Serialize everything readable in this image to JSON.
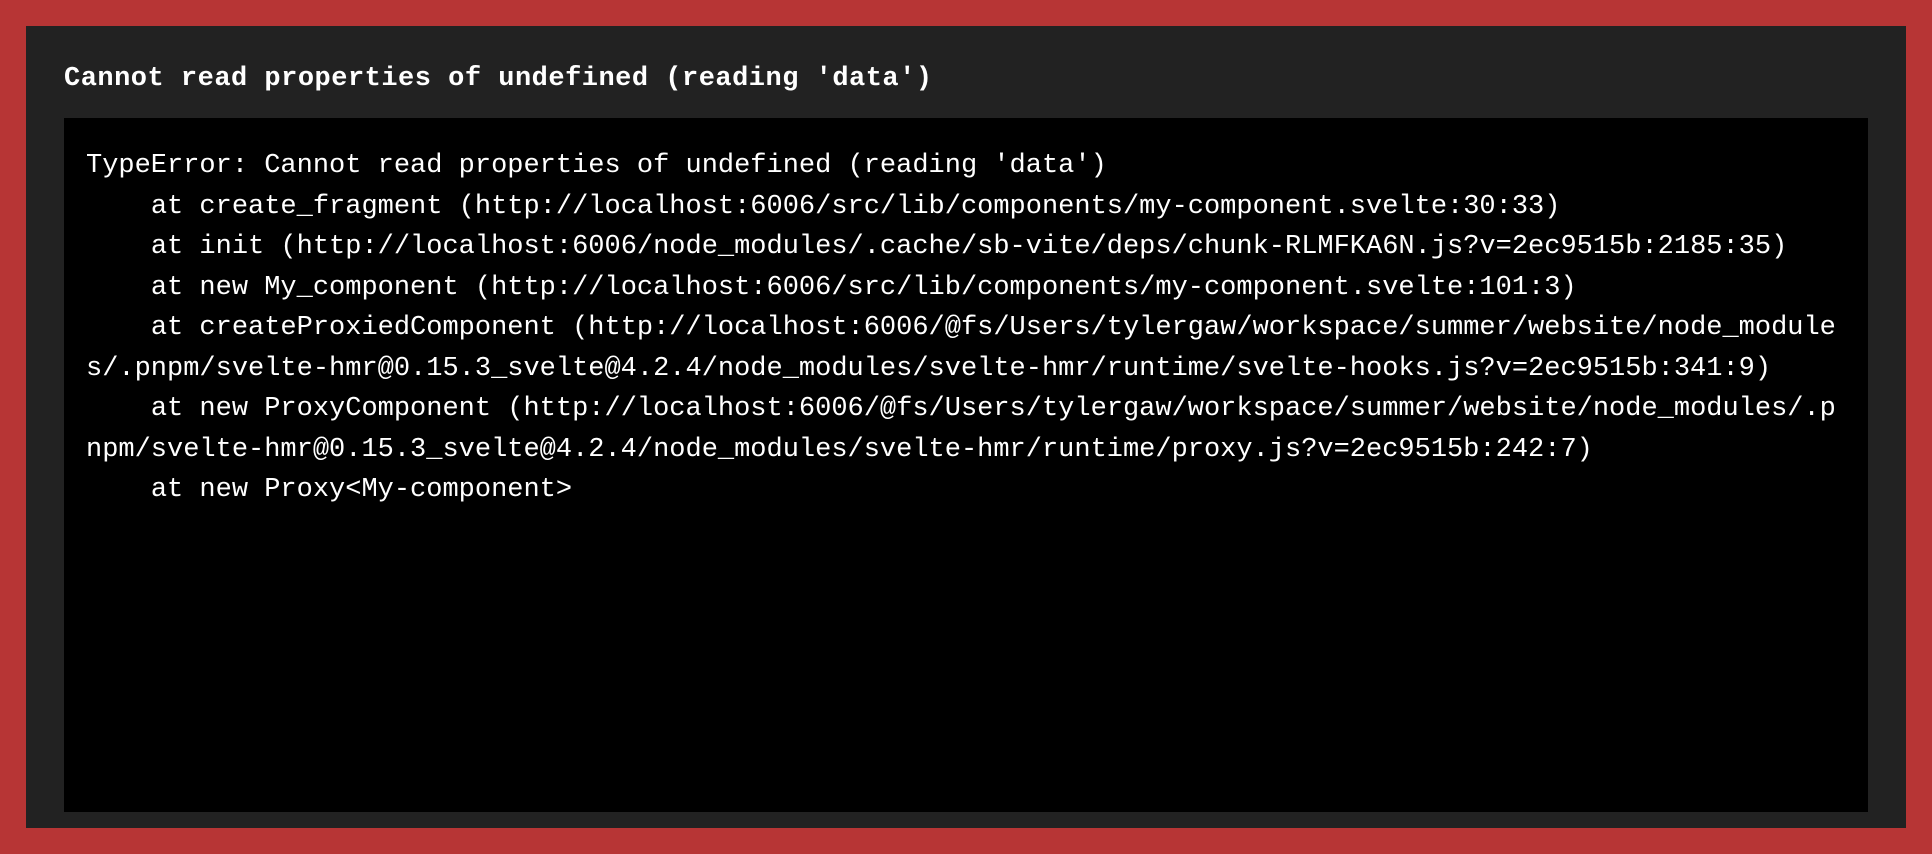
{
  "error": {
    "title": "Cannot read properties of undefined (reading 'data')",
    "stack_trace": "TypeError: Cannot read properties of undefined (reading 'data')\n    at create_fragment (http://localhost:6006/src/lib/components/my-component.svelte:30:33)\n    at init (http://localhost:6006/node_modules/.cache/sb-vite/deps/chunk-RLMFKA6N.js?v=2ec9515b:2185:35)\n    at new My_component (http://localhost:6006/src/lib/components/my-component.svelte:101:3)\n    at createProxiedComponent (http://localhost:6006/@fs/Users/tylergaw/workspace/summer/website/node_modules/.pnpm/svelte-hmr@0.15.3_svelte@4.2.4/node_modules/svelte-hmr/runtime/svelte-hooks.js?v=2ec9515b:341:9)\n    at new ProxyComponent (http://localhost:6006/@fs/Users/tylergaw/workspace/summer/website/node_modules/.pnpm/svelte-hmr@0.15.3_svelte@4.2.4/node_modules/svelte-hmr/runtime/proxy.js?v=2ec9515b:242:7)\n    at new Proxy<My-component>"
  },
  "colors": {
    "background": "#b73535",
    "panel": "#222222",
    "stack_bg": "#000000",
    "text": "#ffffff"
  }
}
